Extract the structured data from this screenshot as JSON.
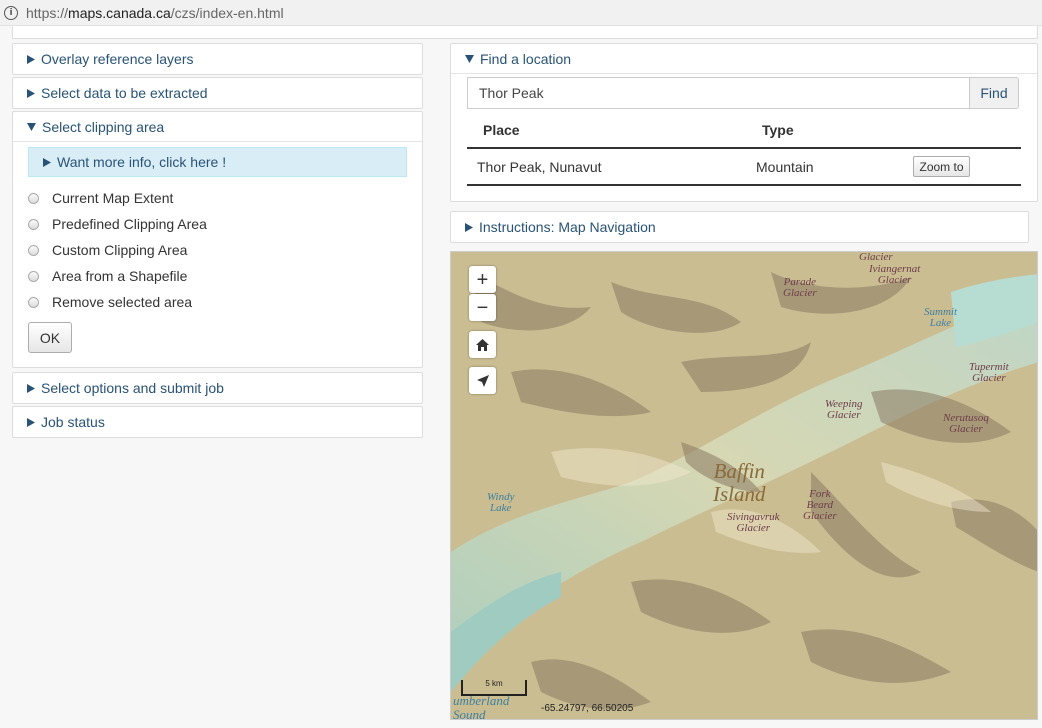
{
  "address_bar": {
    "info_icon_glyph": "i",
    "url_scheme": "https://",
    "url_host": "maps.canada.ca",
    "url_path": "/czs/index-en.html"
  },
  "left_panels": {
    "overlay": "Overlay reference layers",
    "select_data": "Select data to be extracted",
    "clipping": {
      "title": "Select clipping area",
      "more_info": "Want more info, click here !",
      "options": [
        "Current Map Extent",
        "Predefined Clipping Area",
        "Custom Clipping Area",
        "Area from a Shapefile",
        "Remove selected area"
      ],
      "ok_label": "OK"
    },
    "submit": "Select options and submit job",
    "job_status": "Job status"
  },
  "find_location": {
    "title": "Find a location",
    "search_value": "Thor Peak",
    "find_label": "Find",
    "columns": [
      "Place",
      "Type"
    ],
    "results": [
      {
        "place": "Thor Peak, Nunavut",
        "type": "Mountain",
        "action": "Zoom to"
      }
    ]
  },
  "instructions": {
    "title": "Instructions: Map Navigation"
  },
  "map": {
    "controls": {
      "zoom_in": "+",
      "zoom_out": "−"
    },
    "labels": {
      "glacier_top": "Glacier",
      "parade": "Parade\nGlacier",
      "iviangernat": "Iviangernat\nGlacier",
      "summit_lake": "Summit\nLake",
      "tupermit": "Tupermit\nGlacier",
      "weeping": "Weeping\nGlacier",
      "nerutusoq": "Nerutusoq\nGlacier",
      "baffin": "Baffin\nIsland",
      "fork_beard": "Fork\nBeard\nGlacier",
      "sivingavruk": "Sivingavruk\nGlacier",
      "windy_lake": "Windy\nLake",
      "sound": "umberland\nSound"
    },
    "scale_label": "5 km",
    "coordinates": "-65.24797, 66.50205"
  },
  "colors": {
    "accent": "#295376",
    "info_bg": "#d9edf7",
    "water": "#b5d9cd",
    "terrain": "#cbbd92"
  }
}
